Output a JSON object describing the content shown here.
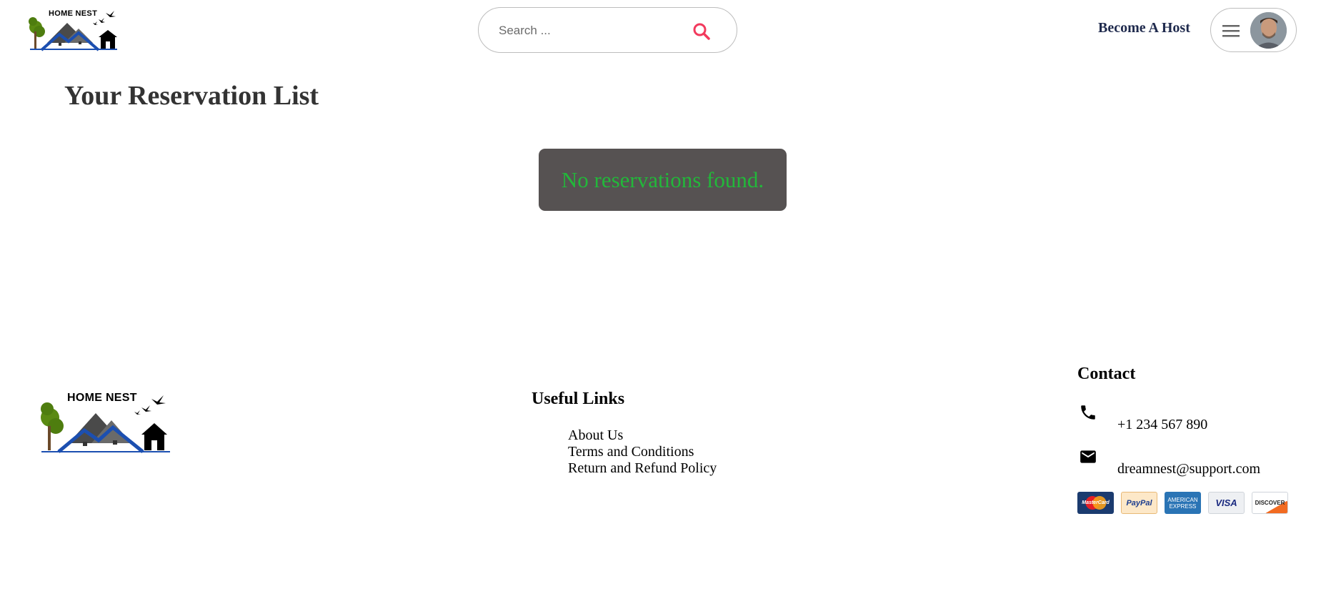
{
  "header": {
    "logo_text": "HOME NEST",
    "search": {
      "placeholder": "Search ..."
    },
    "become_host_label": "Become A Host"
  },
  "main": {
    "title": "Your Reservation List",
    "empty_message": "No reservations found."
  },
  "footer": {
    "logo_text": "HOME NEST",
    "useful_links": {
      "heading": "Useful Links",
      "items": [
        "About Us",
        "Terms and Conditions",
        "Return and Refund Policy"
      ]
    },
    "contact": {
      "heading": "Contact",
      "phone": "+1 234 567 890",
      "email": "dreamnest@support.com"
    },
    "payment_methods": [
      {
        "name": "MasterCard",
        "icon": "mastercard-icon"
      },
      {
        "name": "PayPal",
        "icon": "paypal-icon"
      },
      {
        "name": "AMERICAN EXPRESS",
        "icon": "amex-icon"
      },
      {
        "name": "VISA",
        "icon": "visa-icon"
      },
      {
        "name": "DISCOVER",
        "icon": "discover-icon"
      }
    ]
  },
  "colors": {
    "accent": "#f23a5d",
    "host_link": "#1f2a4d",
    "empty_box_bg": "#565252",
    "empty_text": "#22b83a",
    "title": "#333333"
  }
}
